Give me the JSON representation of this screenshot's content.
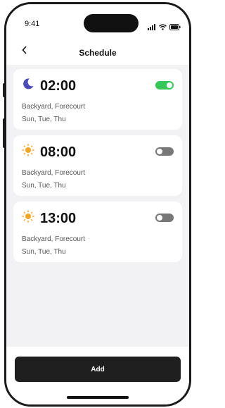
{
  "status_bar": {
    "time": "9:41",
    "icons": [
      "signal-icon",
      "wifi-icon",
      "battery-icon"
    ]
  },
  "header": {
    "back_icon": "chevron-left-icon",
    "title": "Schedule"
  },
  "schedules": [
    {
      "time": "02:00",
      "icon": "moon-icon",
      "icon_color": "#4a4ab8",
      "locations": "Backyard, Forecourt",
      "days": "Sun, Tue, Thu",
      "enabled": true
    },
    {
      "time": "08:00",
      "icon": "sun-icon",
      "icon_color": "#f5a623",
      "locations": "Backyard, Forecourt",
      "days": "Sun, Tue, Thu",
      "enabled": false
    },
    {
      "time": "13:00",
      "icon": "sun-icon",
      "icon_color": "#f5a623",
      "locations": "Backyard, Forecourt",
      "days": "Sun, Tue, Thu",
      "enabled": false
    }
  ],
  "footer": {
    "add_label": "Add"
  },
  "colors": {
    "toggle_on": "#35c759",
    "toggle_off": "#777777",
    "button": "#1f1f1f"
  }
}
